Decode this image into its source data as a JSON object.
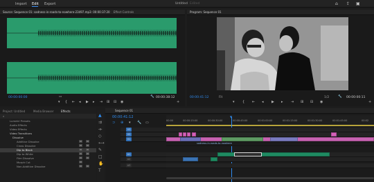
{
  "topbar": {
    "menu": [
      "Import",
      "Edit",
      "Export"
    ],
    "active": "Edit",
    "title": "Untitled",
    "status": "Edited"
  },
  "source": {
    "tab": "Source: Sequence 01: sadness-in-roads-to-nowhere-23497.mp3: 00:00:37:20",
    "tab2": "Effect Controls",
    "timecode_in": "00:00:00:00",
    "fit": "",
    "timecode_out": "00:00:38:12"
  },
  "program": {
    "tab": "Program: Sequence 01",
    "timecode": "00:00:41:12",
    "fit": "Fit",
    "scale": "1/2",
    "duration": "00:00:00:11"
  },
  "project": {
    "tabs": [
      "Project: Untitled",
      "Media Browser",
      "Effects"
    ],
    "active": "Effects",
    "items": [
      "Lumetri Presets",
      "Audio Effects",
      "Video Effects",
      "Video Transitions",
      "Dissolve",
      "Additive Dissolve",
      "Cross Dissolve",
      "Dip to Black",
      "Dip to White",
      "Film Dissolve",
      "Morph Cut",
      "Non-Additive Dissolve"
    ]
  },
  "timeline": {
    "tab": "Sequence 01",
    "timecode": "00:00:41:12",
    "ruler": [
      "00:00",
      "00:00:15:00",
      "00:00:30:00",
      "00:00:45:00",
      "00:01:00:00",
      "00:01:15:00",
      "00:01:30:00",
      "00:01:45:00",
      "00:02"
    ],
    "tracks": [
      "V3",
      "V2",
      "V1",
      "A1",
      "A2",
      "A3"
    ],
    "clip_label": "sadness-in-roads-to-nowhere"
  },
  "colors": {
    "accent": "#2f8cf0",
    "wave": "#2a9b6c",
    "video_clip": "#d45fb8",
    "audio_clip": "#1f8a61"
  }
}
